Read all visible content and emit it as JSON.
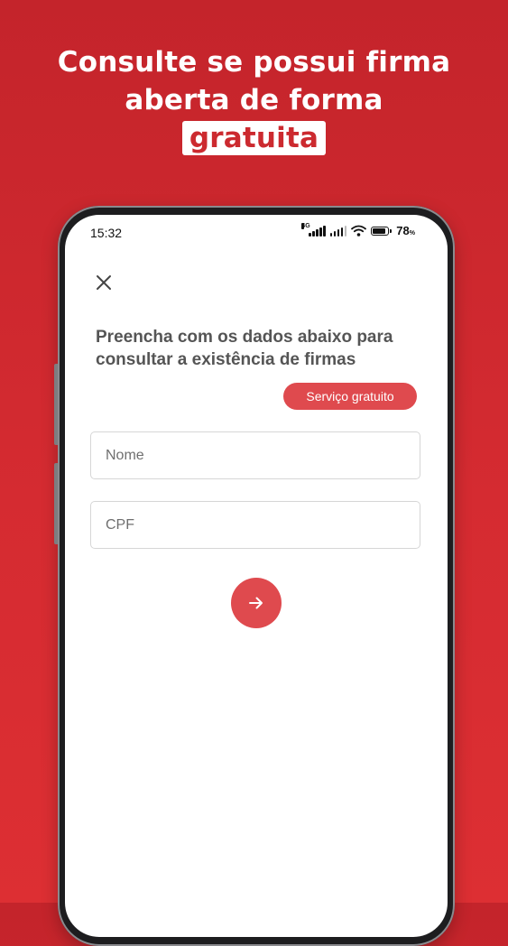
{
  "promo": {
    "headline_line1": "Consulte se possui firma",
    "headline_line2": "aberta de forma",
    "headline_highlight": "gratuita"
  },
  "status_bar": {
    "time": "15:32",
    "network": "4G",
    "battery_percent": "78",
    "battery_symbol": "%",
    "battery_level": 0.78,
    "icons": [
      "signal-bars-icon",
      "signal-bars-icon",
      "wifi-icon",
      "battery-icon"
    ]
  },
  "screen": {
    "close_icon": "close-icon",
    "title": "Preencha com os dados abaixo para consultar a existência de firmas",
    "badge": "Serviço gratuito",
    "fields": {
      "nome": {
        "placeholder": "Nome",
        "value": ""
      },
      "cpf": {
        "placeholder": "CPF",
        "value": ""
      }
    },
    "submit_icon": "arrow-right-icon"
  },
  "colors": {
    "background": "#d52b31",
    "accent": "#df4a4e",
    "title_text": "#555555",
    "white": "#ffffff"
  }
}
